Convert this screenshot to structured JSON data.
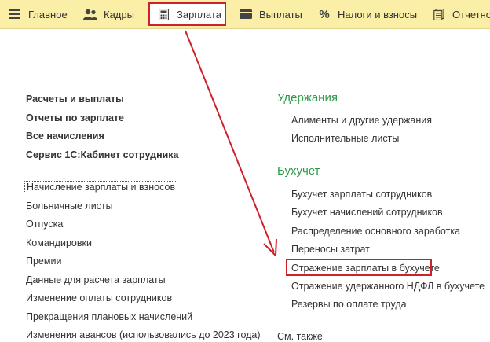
{
  "toolbar": {
    "tabs": [
      {
        "label": "Главное",
        "icon": "hamburger-icon"
      },
      {
        "label": "Кадры",
        "icon": "people-icon"
      },
      {
        "label": "Зарплата",
        "icon": "calculator-icon",
        "active": true
      },
      {
        "label": "Выплаты",
        "icon": "card-icon"
      },
      {
        "label": "Налоги и взносы",
        "icon": "percent-icon"
      },
      {
        "label": "Отчетно",
        "icon": "documents-icon"
      }
    ]
  },
  "left": {
    "bold_links": [
      "Расчеты и выплаты",
      "Отчеты по зарплате",
      "Все начисления",
      "Сервис 1С:Кабинет сотрудника"
    ],
    "links": [
      "Начисление зарплаты и взносов",
      "Больничные листы",
      "Отпуска",
      "Командировки",
      "Премии",
      "Данные для расчета зарплаты",
      "Изменение оплаты сотрудников",
      "Прекращения плановых начислений",
      "Изменения авансов (использовались до 2023 года)"
    ]
  },
  "right": {
    "sections": [
      {
        "title": "Удержания",
        "links": [
          "Алименты и другие удержания",
          "Исполнительные листы"
        ]
      },
      {
        "title": "Бухучет",
        "links": [
          "Бухучет зарплаты сотрудников",
          "Бухучет начислений сотрудников",
          "Распределение основного заработка",
          "Переносы затрат",
          "Отражение зарплаты в бухучете",
          "Отражение удержанного НДФЛ в бухучете",
          "Резервы по оплате труда"
        ]
      }
    ],
    "see_also": "См. также"
  },
  "colors": {
    "toolbar_bg": "#fbeea6",
    "section_title": "#2b9a47",
    "highlight": "#d0212a"
  }
}
